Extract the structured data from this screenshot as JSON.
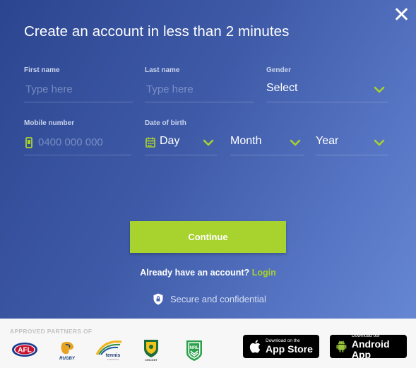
{
  "modal": {
    "title": "Create an account in less than 2 minutes",
    "fields": {
      "first_name": {
        "label": "First name",
        "placeholder": "Type here"
      },
      "last_name": {
        "label": "Last name",
        "placeholder": "Type here"
      },
      "gender": {
        "label": "Gender",
        "value": "Select"
      },
      "mobile": {
        "label": "Mobile number",
        "placeholder": "0400 000 000"
      },
      "dob": {
        "label": "Date of birth",
        "day": "Day",
        "month": "Month",
        "year": "Year"
      }
    },
    "continue_label": "Continue",
    "already_text": "Already have an account?",
    "login_label": "Login",
    "secure_text": "Secure and confidential"
  },
  "footer": {
    "partners_label": "APPROVED PARTNERS OF",
    "partners": [
      "afl-logo",
      "rugby-australia-logo",
      "tennis-australia-logo",
      "cricket-australia-logo",
      "nrl-logo"
    ],
    "app_store": {
      "small": "Download on the",
      "big": "App Store"
    },
    "google_play": {
      "small": "Download our",
      "big": "Android App"
    }
  },
  "colors": {
    "accent": "#a8d22d",
    "gradient_start": "#2c4590",
    "gradient_end": "#6587d2"
  }
}
